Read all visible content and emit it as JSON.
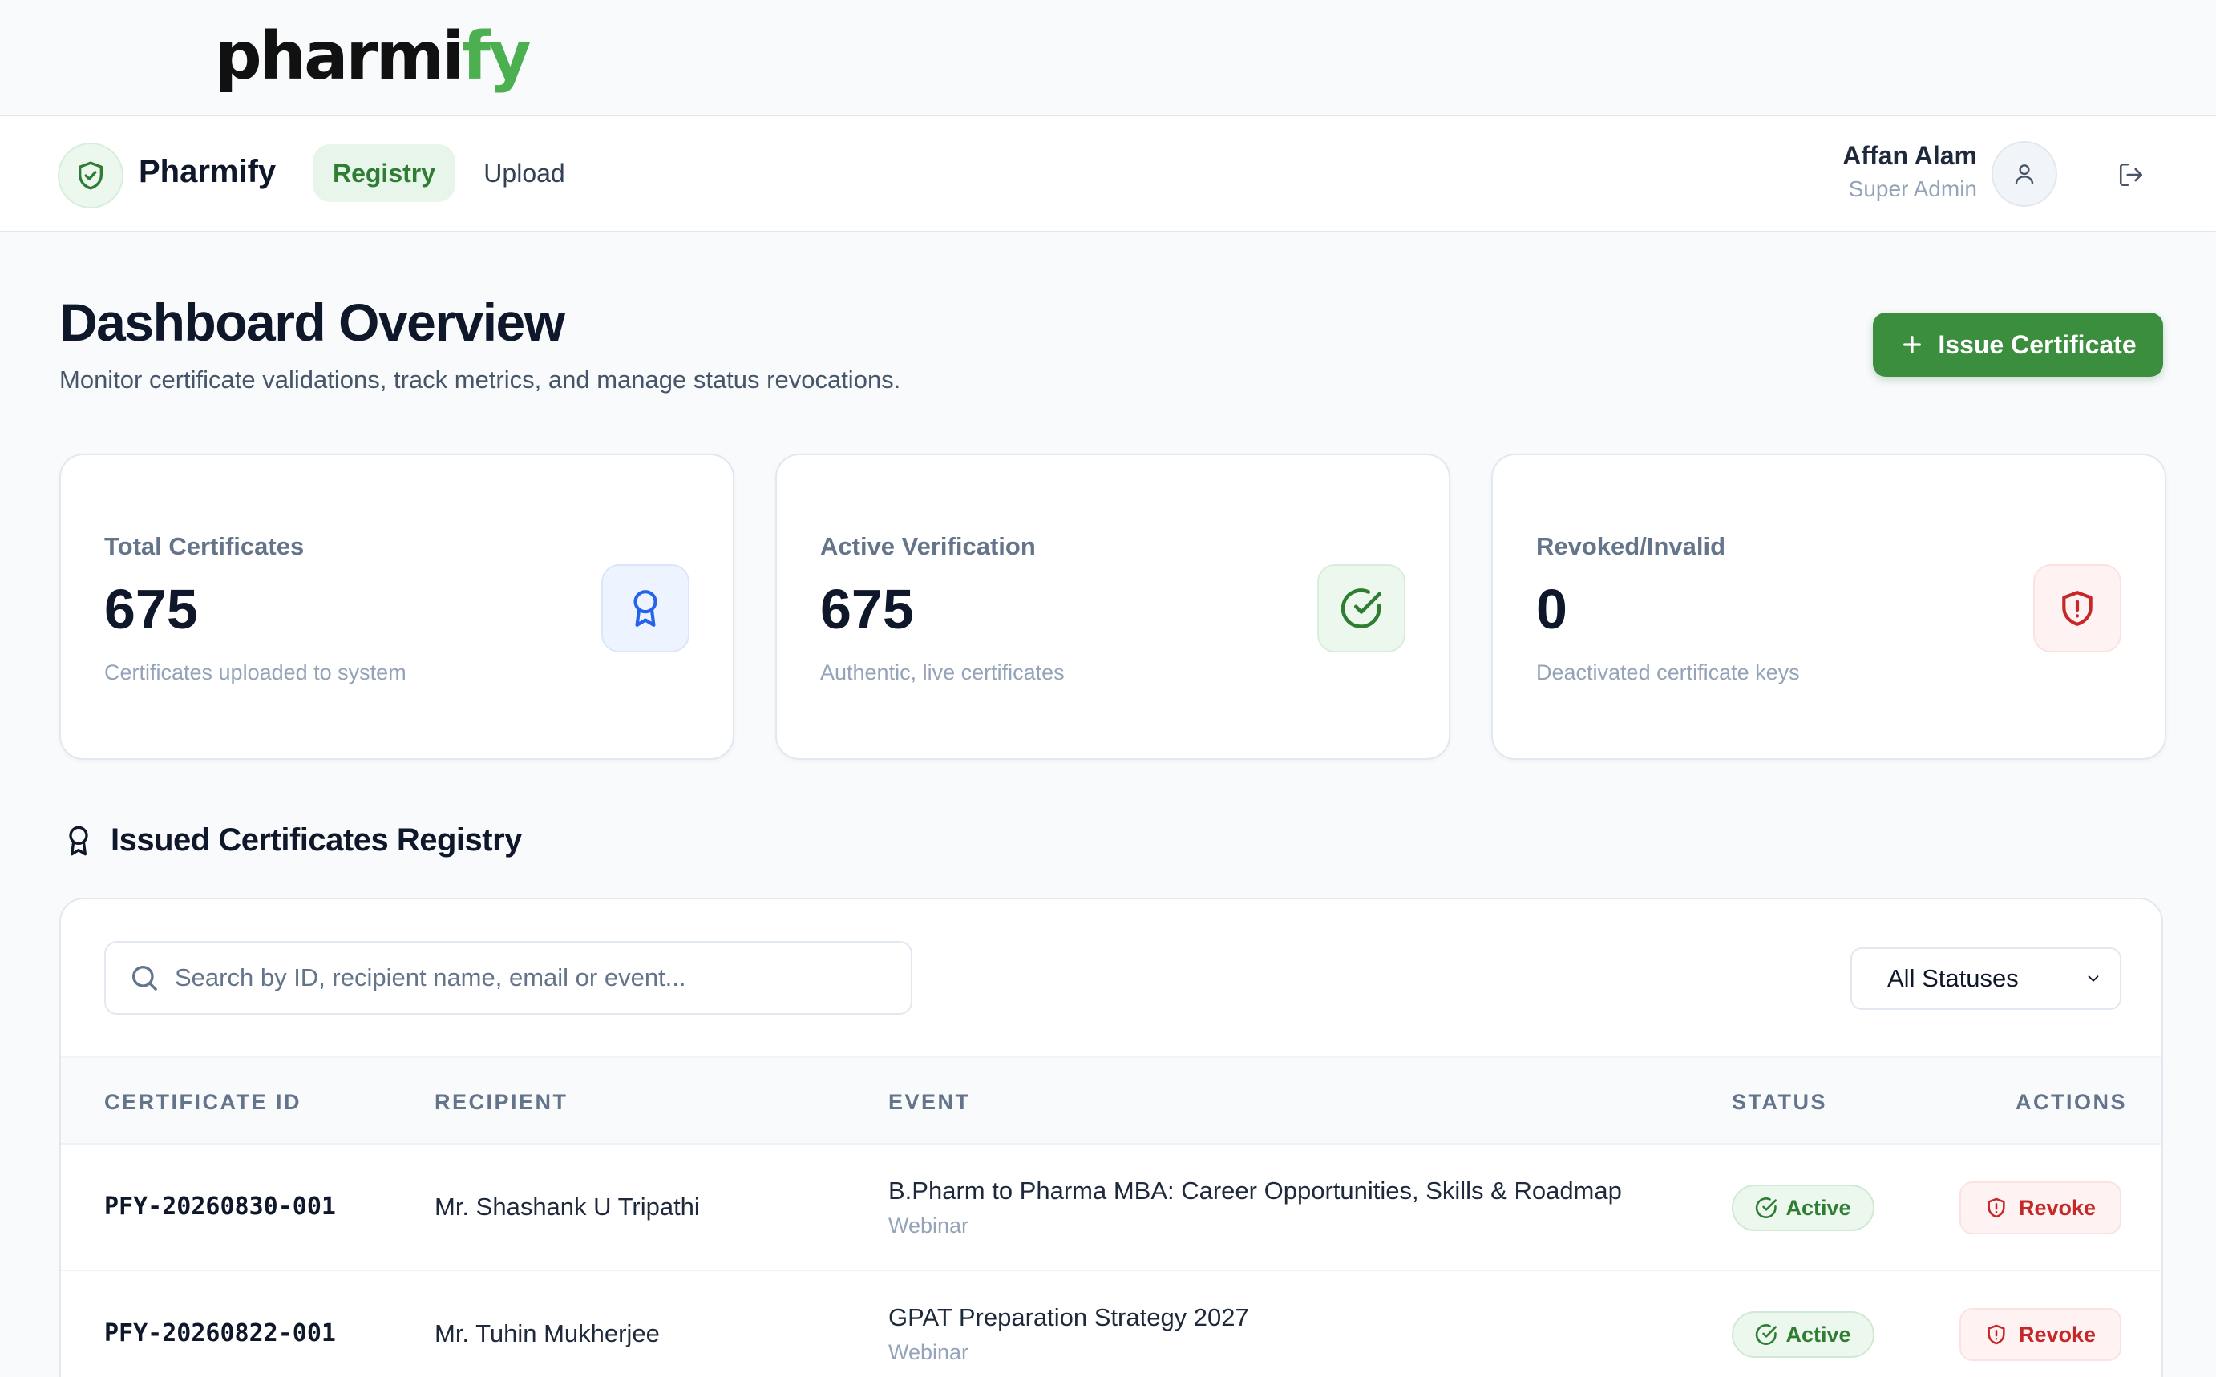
{
  "brand": {
    "logo_dark": "pharmi",
    "logo_green": "fy"
  },
  "nav": {
    "brand_name": "Pharmify",
    "tabs": [
      {
        "label": "Registry",
        "active": true
      },
      {
        "label": "Upload",
        "active": false
      }
    ],
    "user": {
      "name": "Affan Alam",
      "role": "Super Admin"
    },
    "icons": [
      "shield-check-icon",
      "user-icon",
      "logout-icon"
    ]
  },
  "header": {
    "title": "Dashboard Overview",
    "subtitle": "Monitor certificate validations, track metrics, and manage status revocations.",
    "issue_button": "Issue Certificate"
  },
  "stats": [
    {
      "label": "Total Certificates",
      "value": "675",
      "description": "Certificates uploaded to system",
      "icon": "award-icon",
      "color": "#2563eb"
    },
    {
      "label": "Active Verification",
      "value": "675",
      "description": "Authentic, live certificates",
      "icon": "check-circle-icon",
      "color": "#2e7d32"
    },
    {
      "label": "Revoked/Invalid",
      "value": "0",
      "description": "Deactivated certificate keys",
      "icon": "shield-alert-icon",
      "color": "#c62828"
    }
  ],
  "registry": {
    "title": "Issued Certificates Registry",
    "search_placeholder": "Search by ID, recipient name, email or event...",
    "status_filter": "All Statuses",
    "columns": [
      "CERTIFICATE ID",
      "RECIPIENT",
      "EVENT",
      "STATUS",
      "ACTIONS"
    ],
    "rows": [
      {
        "id": "PFY-20260830-001",
        "recipient": "Mr. Shashank U Tripathi",
        "event": "B.Pharm to Pharma MBA: Career Opportunities, Skills & Roadmap",
        "event_type": "Webinar",
        "status": "Active",
        "action": "Revoke"
      },
      {
        "id": "PFY-20260822-001",
        "recipient": "Mr. Tuhin Mukherjee",
        "event": "GPAT Preparation Strategy 2027",
        "event_type": "Webinar",
        "status": "Active",
        "action": "Revoke"
      }
    ]
  },
  "colors": {
    "accent": "#3c8e3f",
    "brand_green": "#4caf50",
    "danger": "#c62828",
    "info": "#2563eb"
  }
}
